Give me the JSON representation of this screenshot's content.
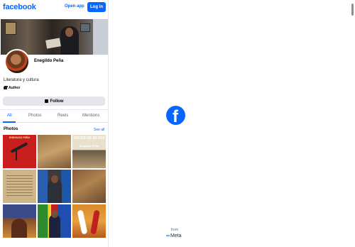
{
  "header": {
    "brand": "facebook",
    "open_app": "Open app",
    "login": "Log in"
  },
  "profile": {
    "name": "Enegildo Peña",
    "intro": "Literatura y cultura",
    "category": "Author",
    "follow_label": "Follow"
  },
  "tabs": [
    {
      "label": "All",
      "active": true
    },
    {
      "label": "Photos",
      "active": false
    },
    {
      "label": "Reels",
      "active": false
    },
    {
      "label": "Mentions",
      "active": false
    }
  ],
  "photos": {
    "title": "Photos",
    "see_all": "See all",
    "tile_text": {
      "t0_title": "ENEGILDO PEÑA",
      "t2_title": "VOCES DE MI VOZ",
      "t2_author": "Enegildo Peña"
    }
  },
  "loader": {
    "from": "from",
    "meta": "Meta"
  },
  "colors": {
    "brand_blue": "#0866ff",
    "button_gray": "#e4e6eb"
  }
}
